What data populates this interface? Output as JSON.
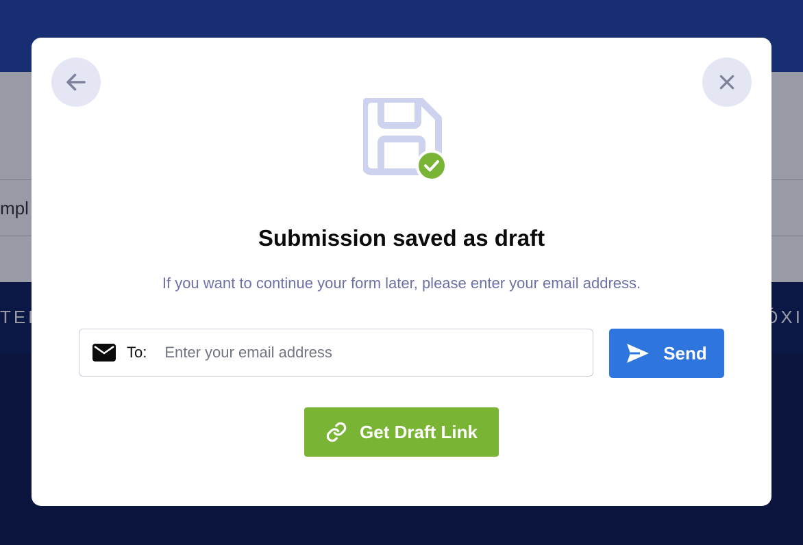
{
  "background": {
    "row_text": "mpl",
    "band_left_text": "TER",
    "band_right_text": "ÓXI"
  },
  "modal": {
    "back_icon": "arrow-left-icon",
    "close_icon": "close-icon",
    "illustration_icon": "floppy-disk-check-icon",
    "title": "Submission saved as draft",
    "subtitle": "If you want to continue your form later, please enter your email address.",
    "email": {
      "icon": "envelope-icon",
      "to_label": "To:",
      "value": "",
      "placeholder": "Enter your email address"
    },
    "send_button": {
      "icon": "paper-plane-icon",
      "label": "Send"
    },
    "draft_link_button": {
      "icon": "link-icon",
      "label": "Get Draft Link"
    }
  },
  "colors": {
    "send": "#2e75de",
    "draft_link": "#7ab435",
    "success_badge": "#7ab435",
    "illustration": "#cdd3ee"
  }
}
